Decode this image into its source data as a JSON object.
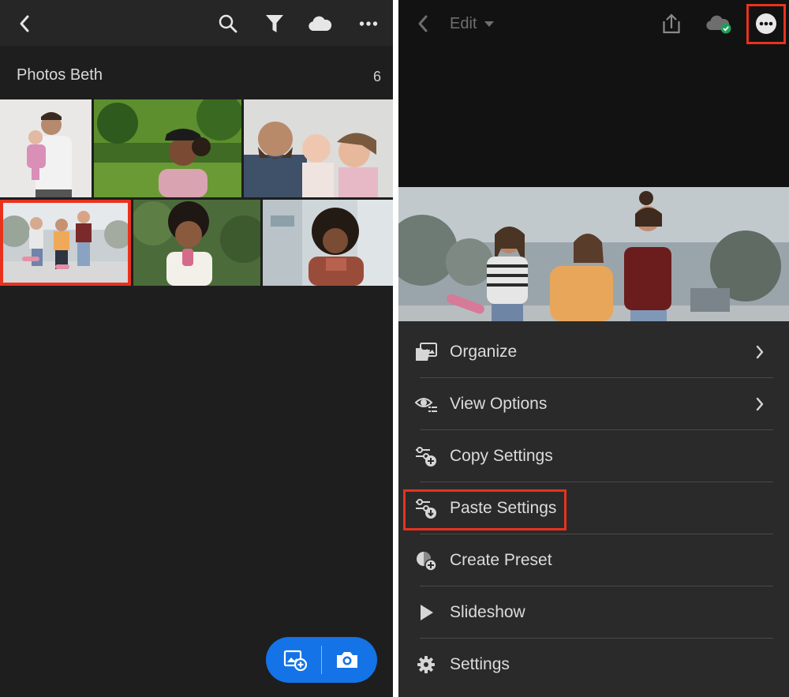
{
  "left": {
    "album": {
      "title": "Photos Beth",
      "count": "6"
    },
    "topbar": {
      "icons": [
        "back-icon",
        "search-icon",
        "filter-icon",
        "cloud-icon",
        "more-icon"
      ]
    },
    "fab": {
      "icons": [
        "add-photo-icon",
        "camera-icon"
      ]
    }
  },
  "right": {
    "topbar": {
      "edit_label": "Edit",
      "icons": [
        "back-icon",
        "share-icon",
        "cloud-synced-icon",
        "more-icon"
      ]
    },
    "menu": {
      "items": [
        {
          "label": "Organize",
          "icon": "folder-image-icon",
          "has_submenu": true
        },
        {
          "label": "View Options",
          "icon": "eye-list-icon",
          "has_submenu": true
        },
        {
          "label": "Copy Settings",
          "icon": "sliders-plus-icon",
          "has_submenu": false
        },
        {
          "label": "Paste Settings",
          "icon": "sliders-down-icon",
          "has_submenu": false
        },
        {
          "label": "Create Preset",
          "icon": "preset-plus-icon",
          "has_submenu": false
        },
        {
          "label": "Slideshow",
          "icon": "play-icon",
          "has_submenu": false
        },
        {
          "label": "Settings",
          "icon": "gear-icon",
          "has_submenu": false
        }
      ]
    }
  },
  "colors": {
    "accent_blue": "#1473e6",
    "highlight_red": "#e8321e",
    "panel_dark": "#1e1e1e",
    "menu_bg": "#2a2a2a"
  }
}
